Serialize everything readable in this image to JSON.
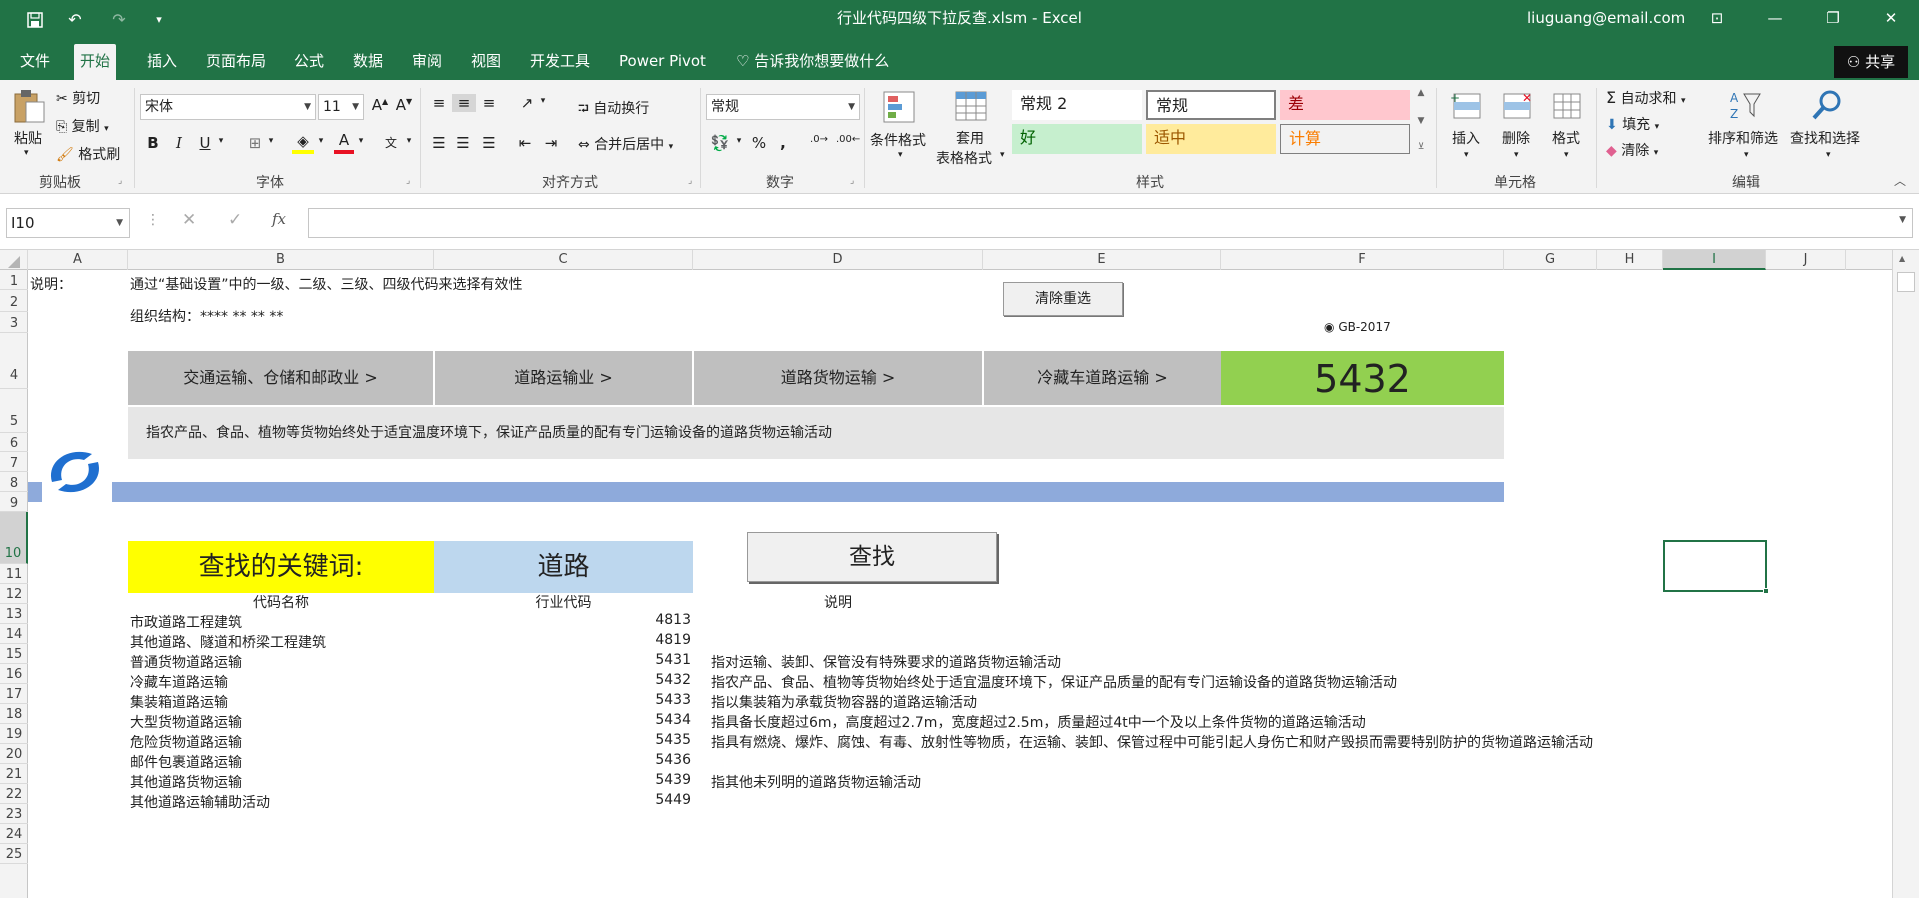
{
  "window": {
    "title": "行业代码四级下拉反查.xlsm  -  Excel",
    "user": "liuguang@email.com"
  },
  "ribbon_tabs": [
    "文件",
    "开始",
    "插入",
    "页面布局",
    "公式",
    "数据",
    "审阅",
    "视图",
    "开发工具",
    "Power Pivot"
  ],
  "tell_me": "告诉我你想要做什么",
  "share": "共享",
  "clipboard": {
    "paste": "粘贴",
    "cut": "剪切",
    "copy": "复制",
    "format_painter": "格式刷",
    "label": "剪贴板"
  },
  "font": {
    "name": "宋体",
    "size": "11",
    "bold": "B",
    "italic": "I",
    "underline": "U",
    "label": "字体"
  },
  "alignment": {
    "wrap": "自动换行",
    "merge": "合并后居中",
    "label": "对齐方式"
  },
  "number": {
    "format": "常规",
    "percent": "%",
    "comma": ",",
    "label": "数字"
  },
  "styles": {
    "conditional": "条件格式",
    "table1": "套用",
    "table2": "表格格式",
    "cells": [
      "常规 2",
      "常规",
      "差",
      "好",
      "适中",
      "计算"
    ],
    "label": "样式"
  },
  "cells_group": {
    "insert": "插入",
    "delete": "删除",
    "format": "格式",
    "label": "单元格"
  },
  "editing": {
    "autosum": "自动求和",
    "fill": "填充",
    "clear": "清除",
    "sort": "排序和筛选",
    "find": "查找和选择",
    "label": "编辑"
  },
  "formula_bar": {
    "name_box": "I10",
    "fx": "fx",
    "value": ""
  },
  "columns": [
    "A",
    "B",
    "C",
    "D",
    "E",
    "F",
    "G",
    "H",
    "I",
    "J"
  ],
  "rows": [
    "1",
    "2",
    "3",
    "4",
    "5",
    "6",
    "7",
    "8",
    "9",
    "10",
    "11",
    "12",
    "13",
    "14",
    "15",
    "16",
    "17",
    "18",
    "19",
    "20",
    "21",
    "22",
    "23",
    "24",
    "25"
  ],
  "sheet": {
    "a1": "说明：",
    "b1": "通过“基础设置”中的一级、二级、三级、四级代码来选择有效性",
    "b2": "组织结构：****  **  **  **",
    "clear_button": "清除重选",
    "gb_label": "GB-2017",
    "levels": [
      "交通运输、仓储和邮政业  >",
      "道路运输业  >",
      "道路货物运输  >",
      "冷藏车道路运输  >"
    ],
    "code": "5432",
    "description": "指农产品、食品、植物等货物始终处于适宜温度环境下，保证产品质量的配有专门运输设备的道路货物运输活动",
    "keyword_label": "查找的关键词:",
    "keyword_value": "道路",
    "find_button": "查找",
    "headers": {
      "name": "代码名称",
      "code": "行业代码",
      "desc": "说明"
    },
    "results": [
      {
        "name": "市政道路工程建筑",
        "code": "4813",
        "desc": ""
      },
      {
        "name": "其他道路、隧道和桥梁工程建筑",
        "code": "4819",
        "desc": ""
      },
      {
        "name": "普通货物道路运输",
        "code": "5431",
        "desc": "指对运输、装卸、保管没有特殊要求的道路货物运输活动"
      },
      {
        "name": "冷藏车道路运输",
        "code": "5432",
        "desc": "指农产品、食品、植物等货物始终处于适宜温度环境下，保证产品质量的配有专门运输设备的道路货物运输活动"
      },
      {
        "name": "集装箱道路运输",
        "code": "5433",
        "desc": "指以集装箱为承载货物容器的道路运输活动"
      },
      {
        "name": "大型货物道路运输",
        "code": "5434",
        "desc": "指具备长度超过6m，高度超过2.7m，宽度超过2.5m，质量超过4t中一个及以上条件货物的道路运输活动"
      },
      {
        "name": "危险货物道路运输",
        "code": "5435",
        "desc": "指具有燃烧、爆炸、腐蚀、有毒、放射性等物质，在运输、装卸、保管过程中可能引起人身伤亡和财产毁损而需要特别防护的货物道路运输活动"
      },
      {
        "name": "邮件包裹道路运输",
        "code": "5436",
        "desc": ""
      },
      {
        "name": "其他道路货物运输",
        "code": "5439",
        "desc": "指其他未列明的道路货物运输活动"
      },
      {
        "name": "其他道路运输辅助活动",
        "code": "5449",
        "desc": ""
      }
    ]
  },
  "colors": {
    "excel_green": "#217346",
    "nav_gray": "#bfbfbf",
    "code_green": "#92d050",
    "band_blue": "#8eaadb",
    "keyword_yellow": "#ffff00",
    "keyword_blue": "#bdd7ee"
  }
}
